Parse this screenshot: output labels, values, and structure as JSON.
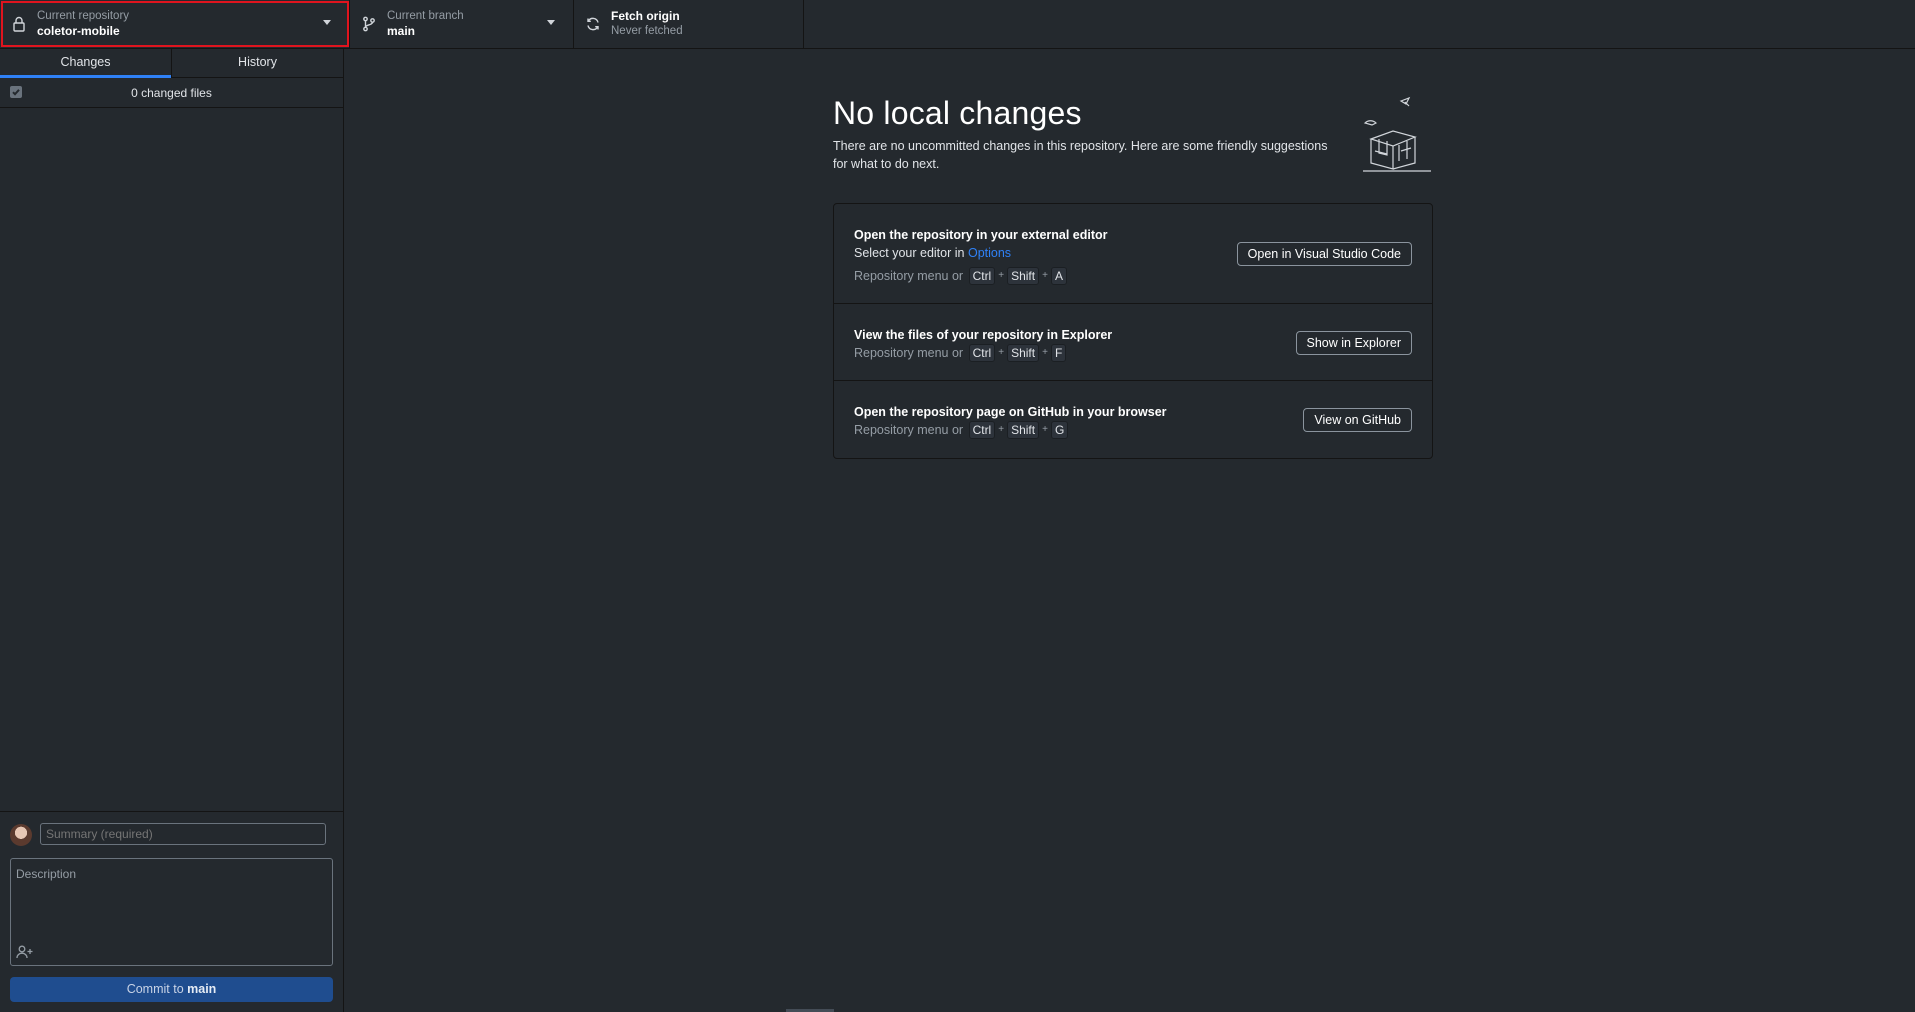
{
  "toolbar": {
    "repository": {
      "label": "Current repository",
      "value": "coletor-mobile",
      "icon": "lock-icon"
    },
    "branch": {
      "label": "Current branch",
      "value": "main",
      "icon": "branch-icon"
    },
    "fetch": {
      "label": "Fetch origin",
      "status": "Never fetched",
      "icon": "sync-icon"
    }
  },
  "sidebar": {
    "tabs": [
      {
        "label": "Changes",
        "active": true
      },
      {
        "label": "History",
        "active": false
      }
    ],
    "changed_files": "0 changed files",
    "commit": {
      "summary_placeholder": "Summary (required)",
      "description_placeholder": "Description",
      "button_prefix": "Commit to",
      "button_branch": "main"
    }
  },
  "main": {
    "title": "No local changes",
    "subtitle": "There are no uncommitted changes in this repository. Here are some friendly suggestions for what to do next.",
    "suggestions": [
      {
        "title": "Open the repository in your external editor",
        "sub_prefix": "Select your editor in",
        "sub_link": "Options",
        "shortcut_prefix": "Repository menu or",
        "keys": [
          "Ctrl",
          "Shift",
          "A"
        ],
        "button": "Open in Visual Studio Code"
      },
      {
        "title": "View the files of your repository in Explorer",
        "shortcut_prefix": "Repository menu or",
        "keys": [
          "Ctrl",
          "Shift",
          "F"
        ],
        "button": "Show in Explorer"
      },
      {
        "title": "Open the repository page on GitHub in your browser",
        "shortcut_prefix": "Repository menu or",
        "keys": [
          "Ctrl",
          "Shift",
          "G"
        ],
        "button": "View on GitHub"
      }
    ]
  },
  "colors": {
    "background": "#24292e",
    "accent": "#2f81f7",
    "highlight": "#e0141e",
    "commit_button": "#1f4d8f"
  }
}
